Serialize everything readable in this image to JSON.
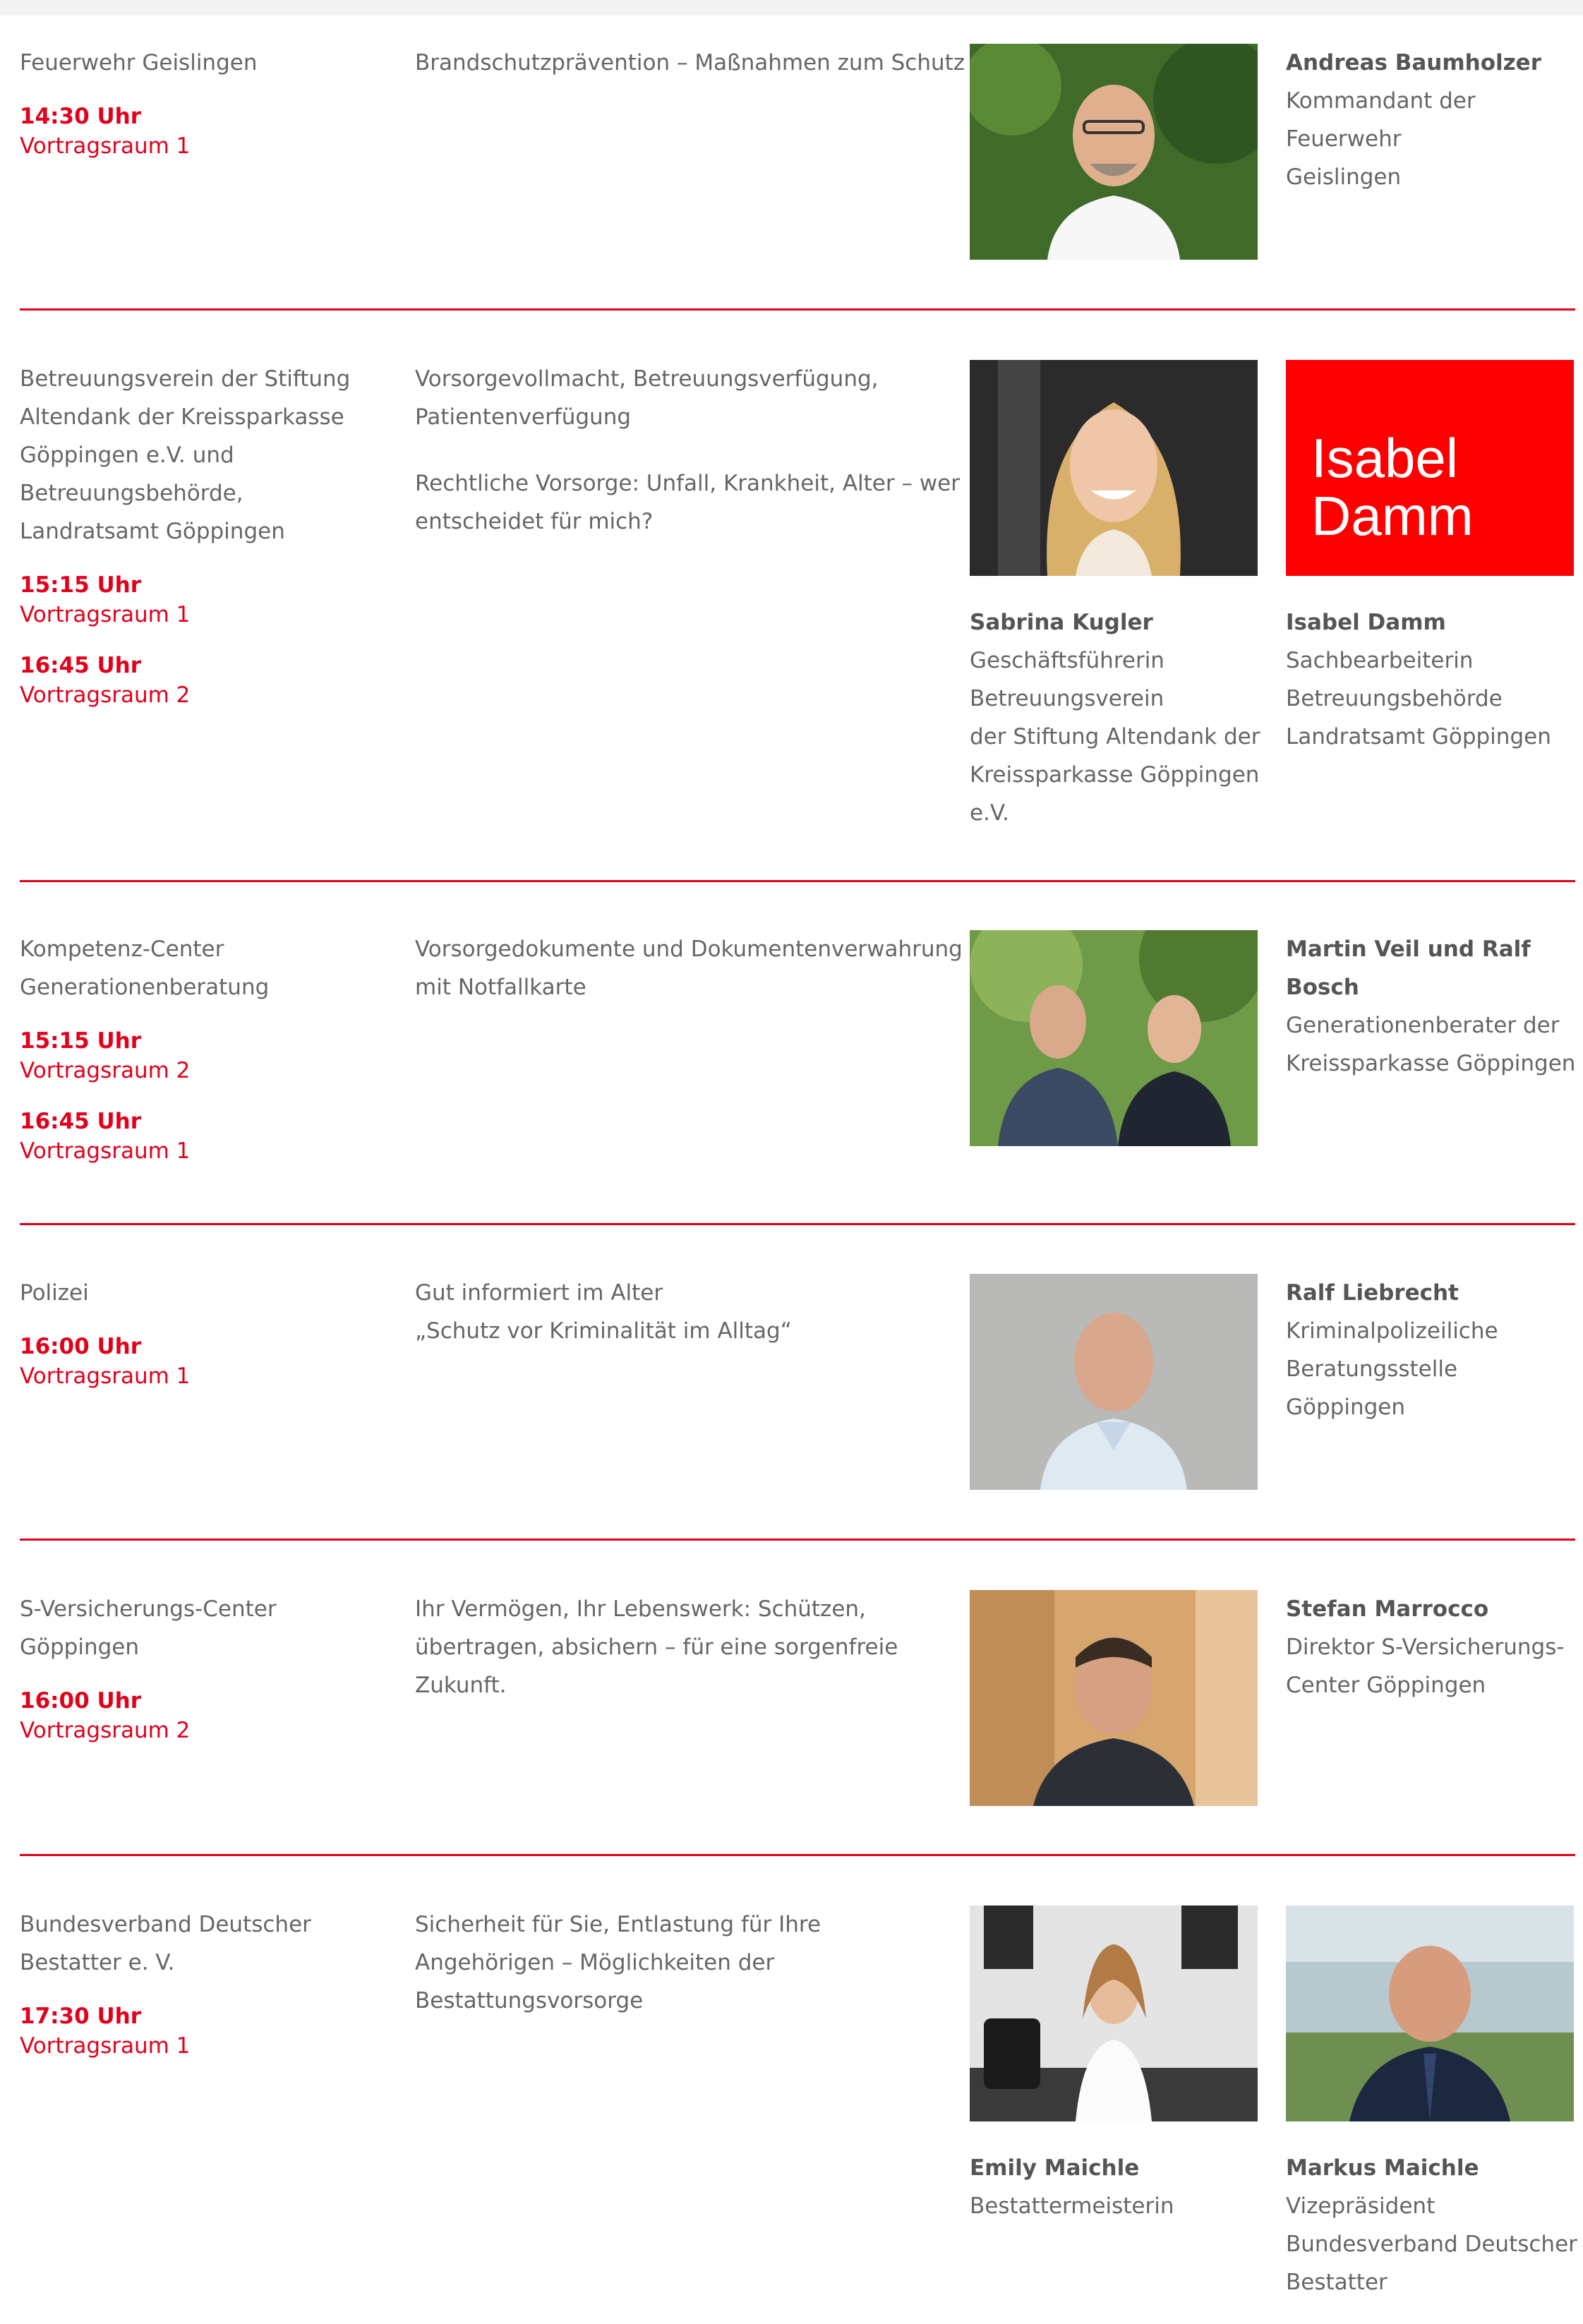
{
  "entries": [
    {
      "org": "Feuerwehr Geislingen",
      "sessions": [
        {
          "time": "14:30 Uhr",
          "room": "Vortragsraum 1"
        }
      ],
      "topic": [
        "Brandschutzprävention – Maßnahmen zum Schutz"
      ],
      "speakers": [
        {
          "name": "Andreas Baumholzer",
          "role": "Kommandant der Feuerwehr\nGeislingen"
        }
      ]
    },
    {
      "org": "Betreuungsverein der Stiftung Altendank der Kreissparkasse Göppingen e.V. und Betreuungsbehörde, Landratsamt Göppingen",
      "sessions": [
        {
          "time": "15:15 Uhr",
          "room": "Vortragsraum 1"
        },
        {
          "time": "16:45 Uhr",
          "room": "Vortragsraum 2"
        }
      ],
      "topic": [
        "Vorsorgevollmacht, Betreuungsverfügung, Patientenverfügung",
        "Rechtliche Vorsorge: Unfall, Krankheit, Alter – wer entscheidet für mich?"
      ],
      "speakers": [
        {
          "name": "Sabrina Kugler",
          "role": "Geschäftsführerin\nBetreuungsverein\nder Stiftung Altendank der\nKreissparkasse Göppingen\ne.V."
        },
        {
          "name": "Isabel Damm",
          "role": "Sachbearbeiterin\nBetreuungsbehörde\nLandratsamt Göppingen",
          "logo_text": "Isabel\nDamm"
        }
      ]
    },
    {
      "org": "Kompetenz-Center Generationenberatung",
      "sessions": [
        {
          "time": "15:15 Uhr",
          "room": "Vortragsraum 2"
        },
        {
          "time": "16:45 Uhr",
          "room": "Vortragsraum 1"
        }
      ],
      "topic": [
        "Vorsorgedokumente und Dokumentenverwahrung mit Notfallkarte"
      ],
      "speakers": [
        {
          "name": "Martin Veil und Ralf Bosch",
          "role": "Generationenberater der\nKreissparkasse Göppingen"
        }
      ]
    },
    {
      "org": "Polizei",
      "sessions": [
        {
          "time": "16:00 Uhr",
          "room": "Vortragsraum 1"
        }
      ],
      "topic": [
        "Gut informiert im Alter\n„Schutz vor Kriminalität im Alltag“"
      ],
      "speakers": [
        {
          "name": "Ralf Liebrecht",
          "role": "Kriminalpolizeiliche\nBeratungsstelle Göppingen"
        }
      ]
    },
    {
      "org": "S-Versicherungs-Center Göppingen",
      "sessions": [
        {
          "time": "16:00 Uhr",
          "room": "Vortragsraum 2"
        }
      ],
      "topic": [
        "Ihr Vermögen, Ihr Lebenswerk: Schützen, übertragen, absichern – für eine sorgenfreie Zukunft."
      ],
      "speakers": [
        {
          "name": "Stefan Marrocco",
          "role": "Direktor S-Versicherungs-\nCenter Göppingen"
        }
      ]
    },
    {
      "org": "Bundesverband Deutscher Bestatter e. V.",
      "sessions": [
        {
          "time": "17:30 Uhr",
          "room": "Vortragsraum 1"
        }
      ],
      "topic": [
        "Sicherheit für Sie, Entlastung für Ihre Angehörigen – Möglichkeiten der Bestattungsvorsorge"
      ],
      "speakers": [
        {
          "name": "Emily Maichle",
          "role": "Bestattermeisterin"
        },
        {
          "name": "Markus Maichle",
          "role": "Vizepräsident\nBundesverband Deutscher\nBestatter"
        }
      ]
    }
  ],
  "colors": {
    "accent": "#e3001b",
    "text": "#666666"
  }
}
